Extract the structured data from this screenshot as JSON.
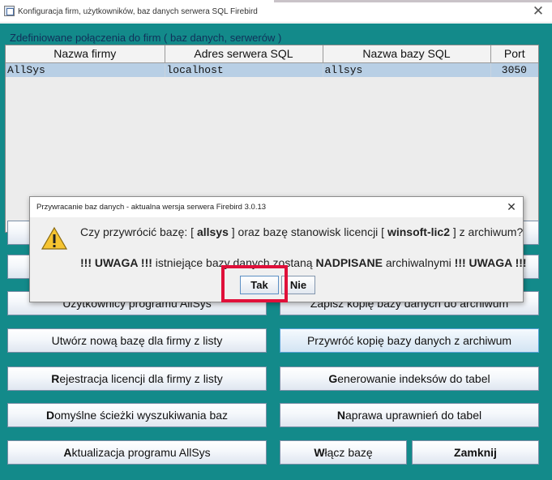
{
  "window": {
    "title": "Konfiguracja firm, użytkowników, baz danych serwera SQL Firebird",
    "close": "✕"
  },
  "group_label": "Zdefiniowane połączenia do firm ( baz danych, serwerów )",
  "table": {
    "headers": [
      "Nazwa firmy",
      "Adres serwera SQL",
      "Nazwa bazy SQL",
      "Port"
    ],
    "rows": [
      [
        "AllSys",
        "localhost",
        "allsys",
        "3050"
      ]
    ]
  },
  "buttons": {
    "users": "Użytkownicy programu AllSys",
    "backup": "Zapisz kopię bazy danych do archiwum",
    "new_db": "Utwórz nową bazę dla firmy z listy",
    "restore": "Przywróć kopię bazy danych z archiwum",
    "license_pre": "R",
    "license_rest": "ejestracja licencji dla firmy z listy",
    "indexes_pre": "G",
    "indexes_rest": "enerowanie indeksów do tabel",
    "paths_pre": "D",
    "paths_rest": "omyślne ścieżki wyszukiwania baz",
    "perms_pre": "N",
    "perms_rest": "aprawa uprawnień do tabel",
    "update_pre": "A",
    "update_rest": "ktualizacja programu AllSys",
    "enable_pre": "W",
    "enable_rest": "łącz bazę",
    "close_pre": "Z",
    "close_rest": "amknij"
  },
  "dialog": {
    "title": "Przywracanie baz danych - aktualna wersja serwera Firebird 3.0.13",
    "close": "✕",
    "line1_a": "Czy przywrócić bazę: [ ",
    "line1_db": "allsys",
    "line1_b": " ] oraz bazę stanowisk licencji [ ",
    "line1_lic": "winsoft-lic2",
    "line1_c": " ] z archiwum?",
    "line2_a": "!!! UWAGA !!!",
    "line2_b": " istniejące bazy danych zostaną ",
    "line2_c": "NADPISANE",
    "line2_d": " archiwalnymi ",
    "line2_e": "!!! UWAGA !!!",
    "yes": "Tak",
    "no": "Nie"
  },
  "colors": {
    "background": "#138a8a",
    "selected_row": "#b8cfe5",
    "highlight": "#e0103a"
  }
}
